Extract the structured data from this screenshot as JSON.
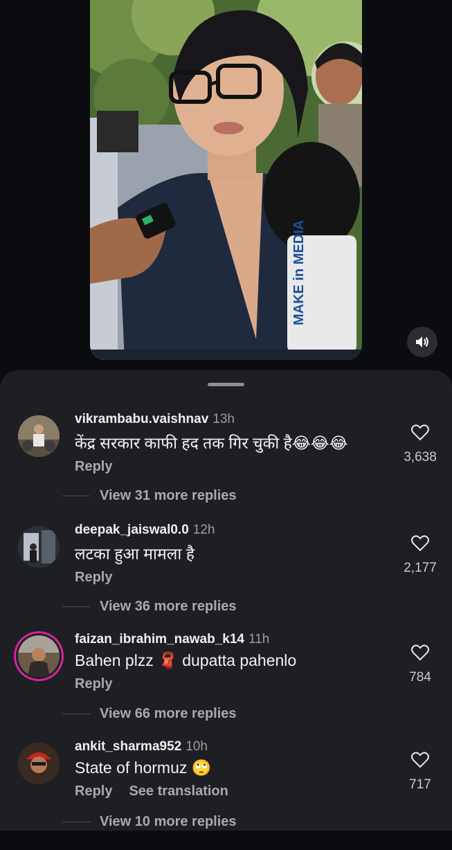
{
  "video": {
    "mic_text": "MAKE in MEDIA",
    "mute_icon": "speaker-muted-icon"
  },
  "comments": [
    {
      "username": "vikrambabu.vaishnav",
      "time": "13h",
      "text": "केंद्र सरकार काफी हद तक गिर चुकी है😂😂😂",
      "reply_label": "Reply",
      "likes": "3,638",
      "view_replies": "View 31 more replies"
    },
    {
      "username": "deepak_jaiswal0.0",
      "time": "12h",
      "text": "लटका हुआ मामला है",
      "reply_label": "Reply",
      "likes": "2,177",
      "view_replies": "View 36 more replies"
    },
    {
      "username": "faizan_ibrahim_nawab_k14",
      "time": "11h",
      "text": "Bahen plzz 🧣 dupatta pahenlo",
      "reply_label": "Reply",
      "likes": "784",
      "view_replies": "View 66 more replies"
    },
    {
      "username": "ankit_sharma952",
      "time": "10h",
      "text": "State of hormuz 🙄",
      "reply_label": "Reply",
      "see_translation": "See translation",
      "likes": "717",
      "view_replies": "View 10 more replies"
    }
  ],
  "colors": {
    "sheet_bg": "#1e1f23",
    "page_bg": "#0b0c10",
    "story_ring": "#d6249f"
  }
}
